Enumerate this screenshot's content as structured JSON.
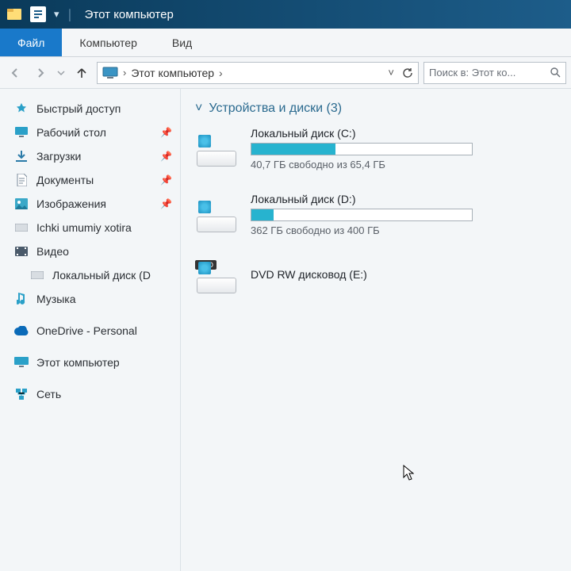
{
  "titlebar": {
    "title": "Этот компьютер"
  },
  "ribbon": {
    "tabs": [
      {
        "label": "Файл"
      },
      {
        "label": "Компьютер"
      },
      {
        "label": "Вид"
      }
    ]
  },
  "nav": {
    "crumb": "Этот компьютер",
    "search_placeholder": "Поиск в: Этот ко..."
  },
  "sidebar": {
    "items": [
      {
        "label": "Быстрый доступ",
        "icon": "star"
      },
      {
        "label": "Рабочий стол",
        "icon": "desktop",
        "pin": true
      },
      {
        "label": "Загрузки",
        "icon": "download",
        "pin": true
      },
      {
        "label": "Документы",
        "icon": "document",
        "pin": true
      },
      {
        "label": "Изображения",
        "icon": "image",
        "pin": true
      },
      {
        "label": "Ichki umumiy xotira",
        "icon": "drive"
      },
      {
        "label": "Видео",
        "icon": "video"
      },
      {
        "label": "Локальный диск (D",
        "icon": "drive",
        "indent": true
      },
      {
        "label": "Музыка",
        "icon": "music"
      },
      {
        "label": "OneDrive - Personal",
        "icon": "cloud"
      },
      {
        "label": "Этот компьютер",
        "icon": "pc"
      },
      {
        "label": "Сеть",
        "icon": "network"
      }
    ]
  },
  "section": {
    "title": "Устройства и диски (3)"
  },
  "drives": [
    {
      "title": "Локальный диск (C:)",
      "subtitle": "40,7 ГБ свободно из 65,4 ГБ",
      "used_pct": 38,
      "type": "hdd"
    },
    {
      "title": "Локальный диск (D:)",
      "subtitle": "362 ГБ свободно из 400 ГБ",
      "used_pct": 10,
      "type": "hdd"
    },
    {
      "title": "DVD RW дисковод (E:)",
      "subtitle": "",
      "type": "dvd"
    }
  ]
}
